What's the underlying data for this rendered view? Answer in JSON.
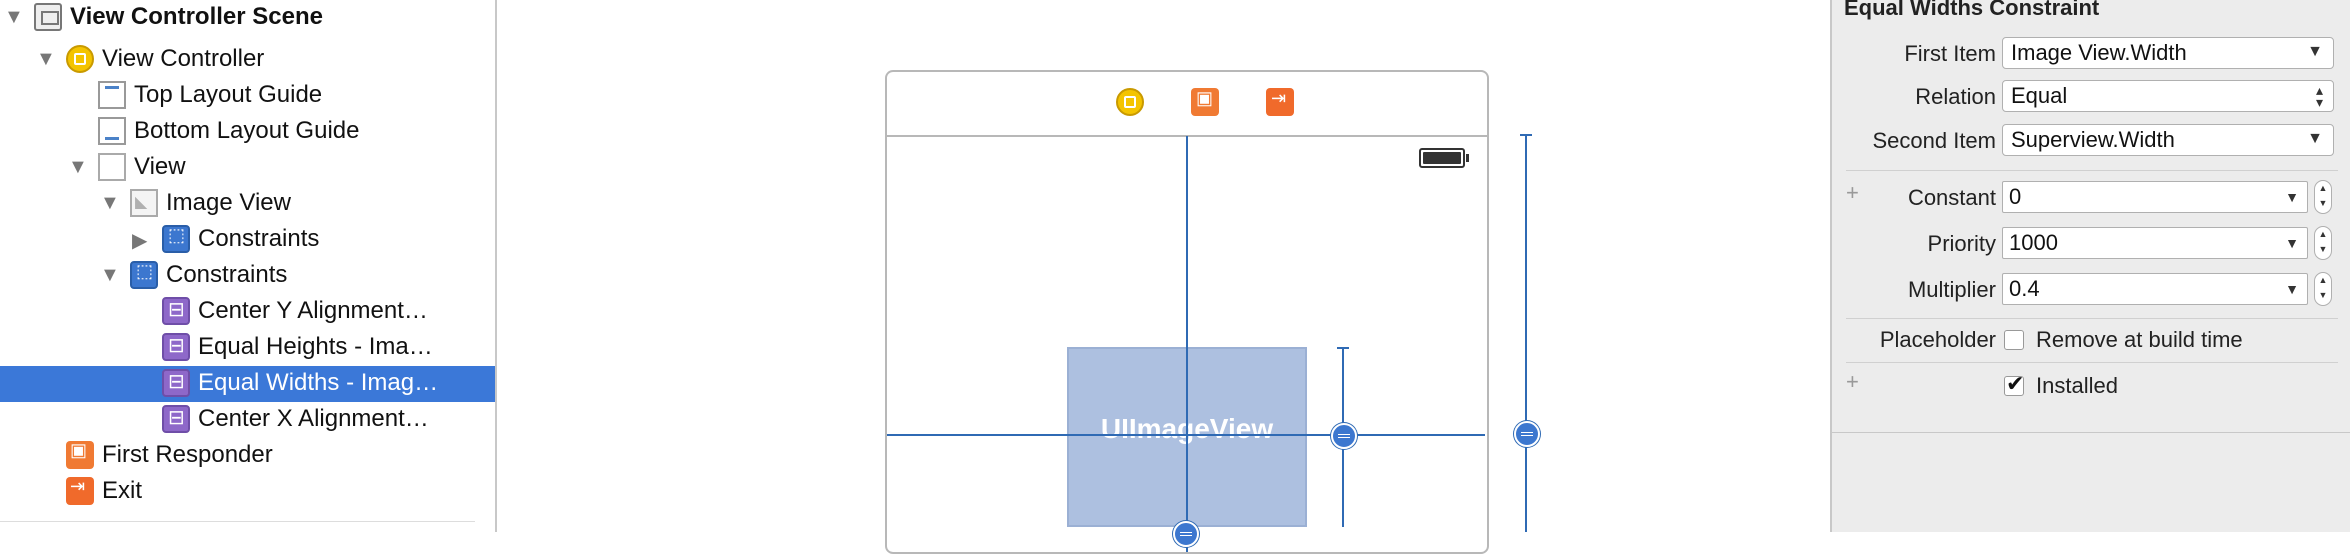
{
  "outline": {
    "items": [
      {
        "label": "View Controller Scene"
      },
      {
        "label": "View Controller"
      },
      {
        "label": "Top Layout Guide"
      },
      {
        "label": "Bottom Layout Guide"
      },
      {
        "label": "View"
      },
      {
        "label": "Image View"
      },
      {
        "label": "Constraints"
      },
      {
        "label": "Constraints"
      },
      {
        "label": "Center Y Alignment…"
      },
      {
        "label": "Equal Heights - Ima…"
      },
      {
        "label": "Equal Widths - Imag…"
      },
      {
        "label": "Center X Alignment…"
      },
      {
        "label": "First Responder"
      },
      {
        "label": "Exit"
      }
    ],
    "selected_index": 10
  },
  "canvas": {
    "image_view_label": "UIImageView"
  },
  "inspector": {
    "title": "Equal Widths Constraint",
    "first_item_label": "First Item",
    "first_item_value": "Image View.Width",
    "relation_label": "Relation",
    "relation_value": "Equal",
    "second_item_label": "Second Item",
    "second_item_value": "Superview.Width",
    "constant_label": "Constant",
    "constant_value": "0",
    "priority_label": "Priority",
    "priority_value": "1000",
    "multiplier_label": "Multiplier",
    "multiplier_value": "0.4",
    "placeholder_label": "Placeholder",
    "remove_at_build_label": "Remove at build time",
    "remove_at_build_checked": false,
    "installed_label": "Installed",
    "installed_checked": true
  },
  "colors": {
    "selection": "#3b78d8",
    "constraint_line": "#2f6ab4",
    "image_view_fill": "#adc0e0",
    "inspector_bg": "#ececec"
  }
}
